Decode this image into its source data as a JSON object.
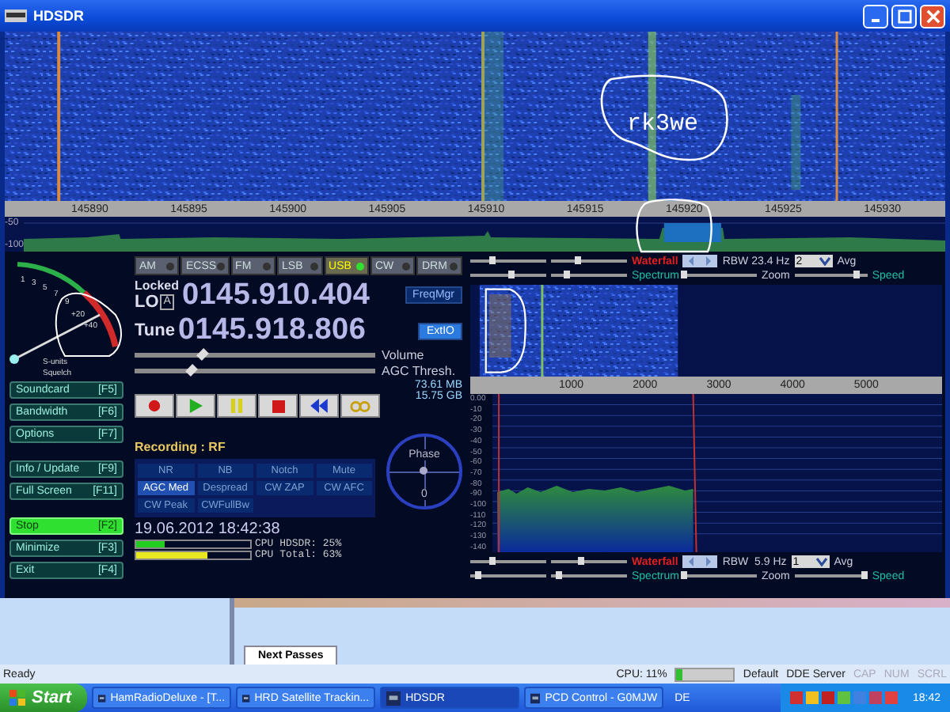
{
  "window": {
    "title": "HDSDR"
  },
  "top_display": {
    "annotation": "rk3we",
    "scale": [
      "145890",
      "145895",
      "145900",
      "145905",
      "145910",
      "145915",
      "145920",
      "145925",
      "145930"
    ],
    "levels": [
      "-50",
      "-100"
    ]
  },
  "modes": [
    {
      "label": "AM",
      "selected": false
    },
    {
      "label": "ECSS",
      "selected": false
    },
    {
      "label": "FM",
      "selected": false
    },
    {
      "label": "LSB",
      "selected": false
    },
    {
      "label": "USB",
      "selected": true
    },
    {
      "label": "CW",
      "selected": false
    },
    {
      "label": "DRM",
      "selected": false
    }
  ],
  "smeter": {
    "scale": [
      "1",
      "3",
      "5",
      "7",
      "9",
      "+20",
      "+40"
    ],
    "units_label": "S-units",
    "squelch_label": "Squelch"
  },
  "lo": {
    "status": "Locked",
    "label": "LO",
    "lock_badge": "A",
    "value": "0145.910.404"
  },
  "tune": {
    "label": "Tune",
    "value": "0145.918.806"
  },
  "freq_buttons": [
    {
      "label": "FreqMgr",
      "active": false
    },
    {
      "label": "ExtIO",
      "active": true
    }
  ],
  "sliders": [
    {
      "label": "Volume",
      "level": 0.28
    },
    {
      "label": "AGC Thresh.",
      "level": 0.24
    }
  ],
  "side_buttons": [
    {
      "label": "Soundcard",
      "key": "[F5]",
      "active": false
    },
    {
      "label": "Bandwidth",
      "key": "[F6]",
      "active": false
    },
    {
      "label": "Options",
      "key": "[F7]",
      "active": false
    },
    {
      "label": "Info / Update",
      "key": "[F9]",
      "active": false
    },
    {
      "label": "Full Screen",
      "key": "[F11]",
      "active": false
    },
    {
      "label": "Stop",
      "key": "[F2]",
      "active": true
    },
    {
      "label": "Minimize",
      "key": "[F3]",
      "active": false
    },
    {
      "label": "Exit",
      "key": "[F4]",
      "active": false
    }
  ],
  "transport": [
    {
      "kind": "record"
    },
    {
      "kind": "play"
    },
    {
      "kind": "pause"
    },
    {
      "kind": "stop"
    },
    {
      "kind": "rewind"
    },
    {
      "kind": "loop"
    }
  ],
  "storage": [
    "73.61 MB",
    "15.75 GB"
  ],
  "recording": "Recording : RF",
  "dsp_buttons": [
    {
      "label": "NR",
      "on": false
    },
    {
      "label": "NB",
      "on": false
    },
    {
      "label": "Notch",
      "on": false
    },
    {
      "label": "Mute",
      "on": false
    },
    {
      "label": "AGC Med",
      "on": true
    },
    {
      "label": "Despread",
      "on": false
    },
    {
      "label": "CW ZAP",
      "on": false
    },
    {
      "label": "CW AFC",
      "on": false
    },
    {
      "label": "CW Peak",
      "on": false
    },
    {
      "label": "CWFullBw",
      "on": false
    }
  ],
  "phase": {
    "label": "Phase",
    "value": "0"
  },
  "datetime": "19.06.2012 18:42:38",
  "cpu": [
    {
      "label": "CPU HDSDR: 25%",
      "level": 0.25,
      "color": "#22cc22"
    },
    {
      "label": "CPU Total: 63%",
      "level": 0.63,
      "color": "#e8e820"
    }
  ],
  "af_top_controls": {
    "waterfall_label": "Waterfall",
    "spectrum_label": "Spectrum",
    "rbw": "RBW 23.4 Hz",
    "avg_value": "2",
    "avg_label": "Avg",
    "zoom_label": "Zoom",
    "speed_label": "Speed",
    "waterfall_sliders": [
      {
        "level": 0.3
      },
      {
        "level": 0.35
      }
    ],
    "spectrum_sliders": [
      {
        "level": 0.55
      },
      {
        "level": 0.2
      }
    ],
    "zoom": {
      "level": 0.0
    },
    "speed": {
      "level": 0.85
    }
  },
  "af_waterfall": {
    "scale": [
      "1000",
      "2000",
      "3000",
      "4000",
      "5000"
    ]
  },
  "af_spectrum": {
    "ticks": [
      "0.00",
      "-10",
      "-20",
      "-30",
      "-40",
      "-50",
      "-60",
      "-70",
      "-80",
      "-90",
      "-100",
      "-110",
      "-120",
      "-130",
      "-140"
    ]
  },
  "af_bottom_controls": {
    "waterfall_label": "Waterfall",
    "spectrum_label": "Spectrum",
    "rbw": "RBW  5.9 Hz",
    "avg_value": "1",
    "avg_label": "Avg",
    "zoom_label": "Zoom",
    "speed_label": "Speed",
    "waterfall_sliders": [
      {
        "level": 0.3
      },
      {
        "level": 0.4
      }
    ],
    "spectrum_sliders": [
      {
        "level": 0.1
      },
      {
        "level": 0.1
      }
    ],
    "zoom": {
      "level": 0.0
    },
    "speed": {
      "level": 0.97
    }
  },
  "background_window": {
    "tab": "Next Passes"
  },
  "status_bar": {
    "ready": "Ready",
    "cpu": "CPU: 11%",
    "cpu_meter": {
      "level": 0.11
    },
    "items": [
      {
        "label": "Default",
        "disabled": false
      },
      {
        "label": "DDE Server",
        "disabled": false
      },
      {
        "label": "CAP",
        "disabled": true
      },
      {
        "label": "NUM",
        "disabled": true
      },
      {
        "label": "SCRL",
        "disabled": true
      }
    ]
  },
  "taskbar": {
    "start": "Start",
    "tasks": [
      {
        "label": "HamRadioDeluxe - [T...",
        "selected": false
      },
      {
        "label": "HRD Satellite Trackin...",
        "selected": false
      },
      {
        "label": "HDSDR",
        "selected": true
      },
      {
        "label": "PCD Control - G0MJW",
        "selected": false
      }
    ],
    "language": "DE",
    "clock": "18:42"
  }
}
